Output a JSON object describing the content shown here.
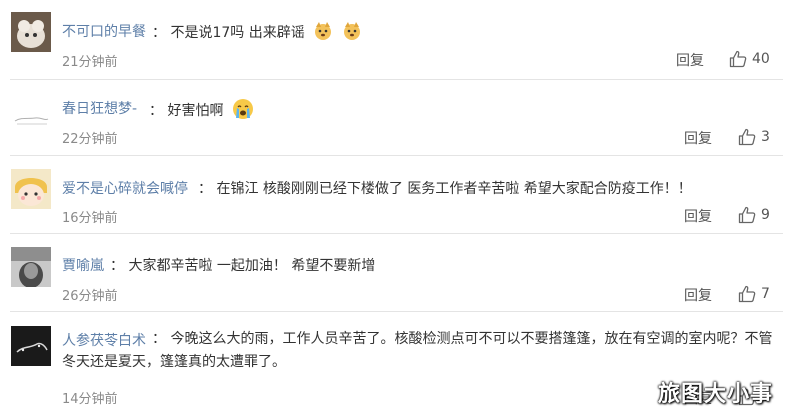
{
  "comments": [
    {
      "author": "不可口的早餐",
      "separator": "：",
      "text": "不是说17吗 出来辟谣",
      "time": "21分钟前",
      "reply": "回复",
      "likes": "40"
    },
    {
      "author": "春日狂想梦-",
      "separator": "：",
      "text": "好害怕啊",
      "time": "22分钟前",
      "reply": "回复",
      "likes": "3"
    },
    {
      "author": "爱不是心碎就会喊停",
      "separator": "：",
      "text": "在锦江 核酸刚刚已经下楼做了 医务工作者辛苦啦 希望大家配合防疫工作！！",
      "time": "16分钟前",
      "reply": "回复",
      "likes": "9"
    },
    {
      "author": "賈喻嵐",
      "separator": "：",
      "text": "大家都辛苦啦 一起加油！ 希望不要新增",
      "time": "26分钟前",
      "reply": "回复",
      "likes": "7"
    },
    {
      "author": "人参茯苓白术",
      "separator": "：",
      "text": "今晚这么大的雨，工作人员辛苦了。核酸检测点可不可以不要搭篷篷，放在有空调的室内呢？不管冬天还是夏天，篷篷真的太遭罪了。",
      "time": "14分钟前",
      "reply": "回复",
      "likes": "6"
    }
  ],
  "watermark": "旅图大小事",
  "colors": {
    "author": "#5e7fa8",
    "text": "#333333",
    "time": "#8a8a8a",
    "divider": "#e4e4e4"
  }
}
